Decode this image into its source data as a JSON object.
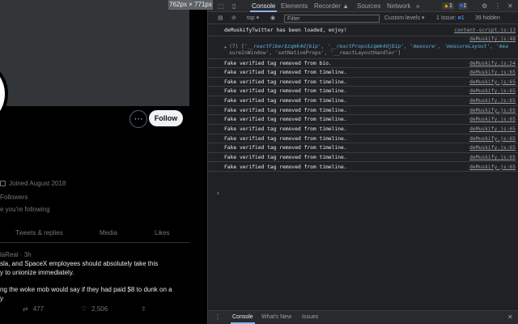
{
  "twitter": {
    "more_label": "···",
    "follow_label": "Follow",
    "joined": "Joined August 2018",
    "followers": "Followers",
    "known": "e you're following",
    "tabs": [
      "Tweets & replies",
      "Media",
      "Likes"
    ],
    "tweet": {
      "handle": "laReal · 3h",
      "line1": "sla, and SpaceX employees should absolutely take this",
      "line2": "y to unionize immediately.",
      "line3": "ng the woke mob would say if they had paid $8 to dunk on a",
      "line4": "y",
      "retweets": "477",
      "likes": "2,506"
    }
  },
  "devtools": {
    "size_badge": "762px × 771px",
    "tabs": [
      "Console",
      "Elements",
      "Recorder ▲",
      "Sources",
      "Network",
      "»"
    ],
    "warn_count": "1",
    "msg_count": "1",
    "toolbar": {
      "context": "top ▾",
      "filter_placeholder": "Filter",
      "levels": "Custom levels ▾",
      "issues": "1 Issue: ",
      "issue_count": "1",
      "hidden": "39 hidden"
    },
    "console": {
      "first_msg": "deMuskifyTwitter has been loaded, enjoy!",
      "first_src": "content-script.js:13",
      "array_src": "deMuskify.js:48",
      "array_line1_pre": "(7) [",
      "array_line1": "'__reactFiber$zqmk4djb1p', '__reactProps$zqmk4djb1p', 'measure', 'measureLayout', 'mea",
      "array_line2": "sureInWindow', 'setNativeProps', '__reactLayoutHandler']",
      "bio_msg": "Fake verified tag removed from bio.",
      "bio_src": "deMuskify.js:54",
      "timeline_msg": "Fake verified tag removed from timeline.",
      "timeline_src": "deMuskify.js:65",
      "timeline_count": 11
    },
    "drawer_tabs": [
      "Console",
      "What's New",
      "Issues"
    ],
    "colors": {
      "warn": "#f9ab00",
      "info": "#1a73e8",
      "accent": "#8ab4f8"
    }
  }
}
